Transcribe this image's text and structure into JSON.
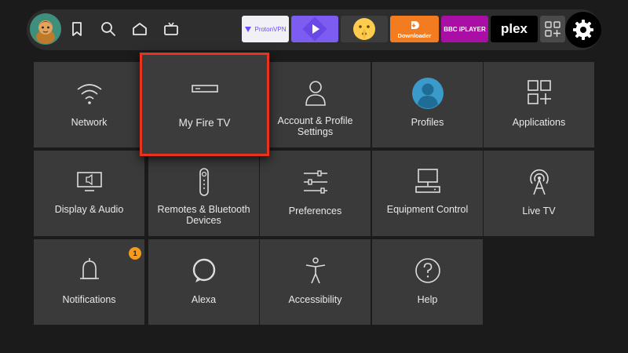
{
  "nav": {
    "icons": [
      "profile-avatar",
      "bookmark-icon",
      "search-icon",
      "home-icon",
      "live-tv-icon"
    ],
    "apps": [
      {
        "name": "ProtonVPN",
        "bg": "#f1f1f5",
        "fg": "#6d4aff"
      },
      {
        "name": "",
        "bg": "#7d5cf2",
        "fg": "#ffffff"
      },
      {
        "name": "",
        "bg": "#3d3d3d",
        "fg": "#ffffff"
      },
      {
        "name": "Downloader",
        "bg": "#f47c20",
        "fg": "#ffffff"
      },
      {
        "name": "BBC iPLAYER",
        "bg": "#a90fa4",
        "fg": "#ffffff"
      },
      {
        "name": "plex",
        "bg": "#000000",
        "fg": "#ffffff"
      }
    ],
    "more_apps_icon": "apps-grid-icon",
    "settings_icon": "gear-icon"
  },
  "settings": [
    {
      "label": "Network",
      "icon": "wifi-icon"
    },
    {
      "label": "My Fire TV",
      "icon": "fire-tv-device-icon",
      "focused": true
    },
    {
      "label": "Account & Profile Settings",
      "icon": "person-icon"
    },
    {
      "label": "Profiles",
      "icon": "profile-avatar-icon"
    },
    {
      "label": "Applications",
      "icon": "applications-grid-icon"
    },
    {
      "label": "Display & Audio",
      "icon": "display-audio-icon"
    },
    {
      "label": "Remotes & Bluetooth Devices",
      "icon": "remote-icon"
    },
    {
      "label": "Preferences",
      "icon": "sliders-icon"
    },
    {
      "label": "Equipment Control",
      "icon": "equipment-icon"
    },
    {
      "label": "Live TV",
      "icon": "antenna-icon"
    },
    {
      "label": "Notifications",
      "icon": "bell-icon",
      "badge": "1"
    },
    {
      "label": "Alexa",
      "icon": "alexa-icon"
    },
    {
      "label": "Accessibility",
      "icon": "accessibility-icon"
    },
    {
      "label": "Help",
      "icon": "help-icon"
    }
  ]
}
